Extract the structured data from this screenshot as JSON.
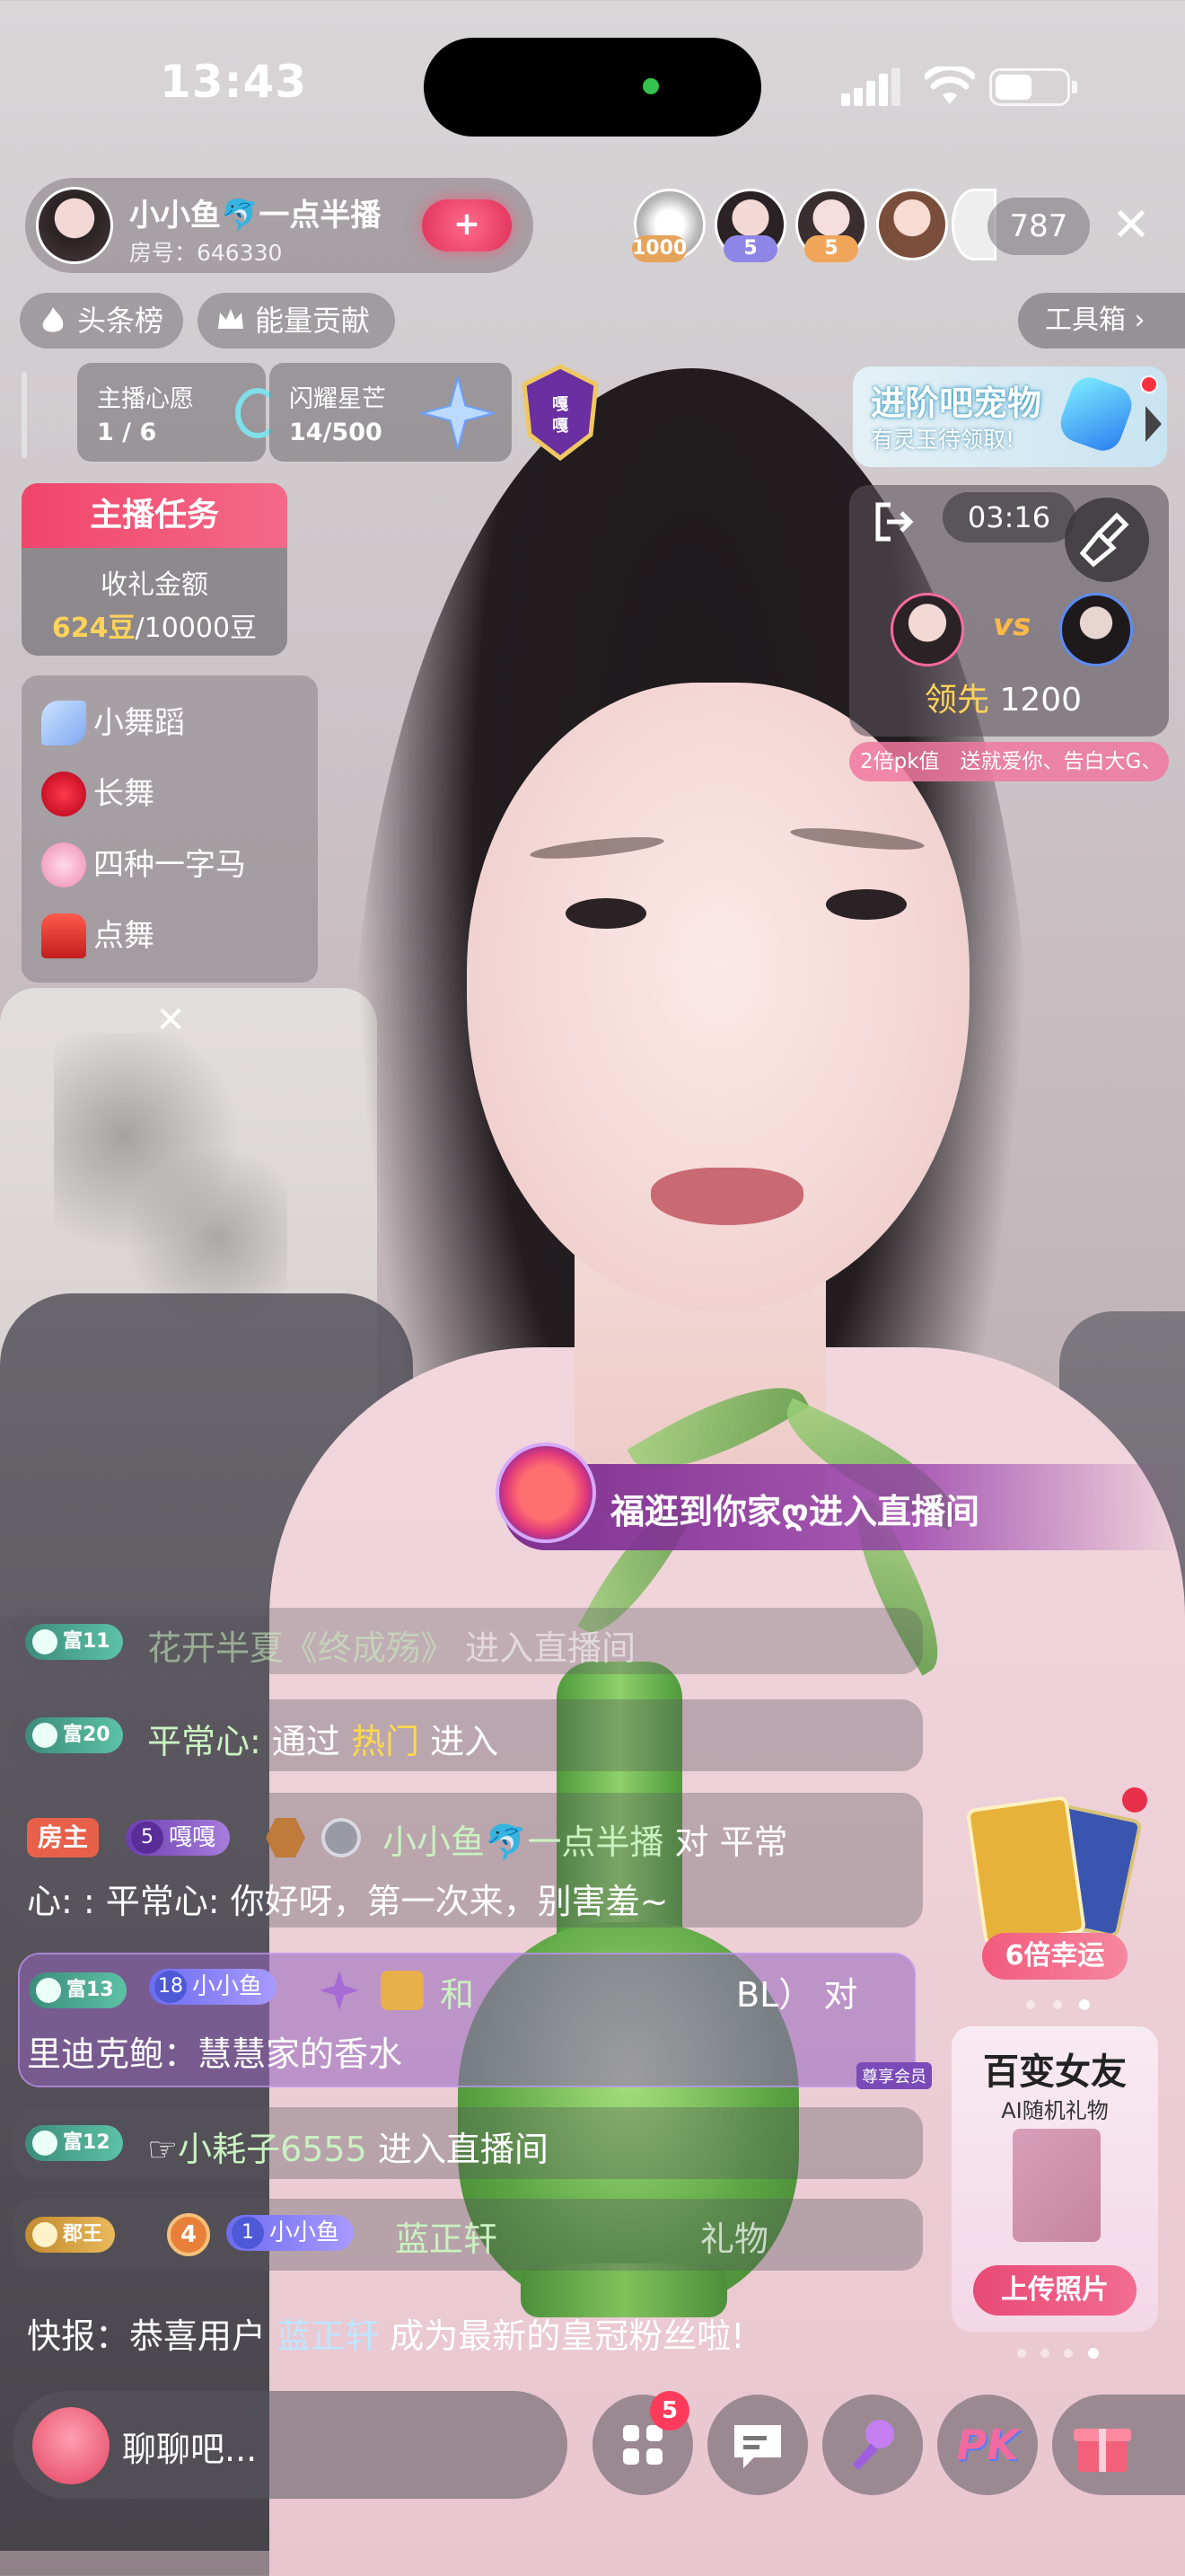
{
  "status_bar": {
    "time": "13:43"
  },
  "host": {
    "name": "小小鱼🐬一点半播",
    "room": "房号：646330",
    "follow_symbol": "+"
  },
  "viewers": {
    "badges": [
      "1000",
      "5",
      "5"
    ],
    "count": "787",
    "close": "✕"
  },
  "top_pills": {
    "headline": "头条榜",
    "energy": "能量贡献",
    "toolbox": "工具箱"
  },
  "missions": {
    "wish_title": "主播心愿",
    "wish_value": "1 / 6",
    "star_title": "闪耀星芒",
    "star_value": "14/500",
    "emblem": "嘎嘎"
  },
  "pet_promo": {
    "title": "进阶吧宠物",
    "subtitle": "有灵玉待领取!"
  },
  "anchor_task": {
    "title": "主播任务",
    "label": "收礼金额",
    "current": "624豆",
    "target": "/10000豆"
  },
  "dance_list": {
    "items": [
      "小舞蹈",
      "长舞",
      "四种一字马",
      "点舞"
    ],
    "close": "✕"
  },
  "pk": {
    "timer": "03:16",
    "vs": "vs",
    "lead_label": "领先",
    "lead_value": "1200",
    "ticker": "2倍pk值　送就爱你、告白大G、"
  },
  "entry_banner": {
    "text": "福逛到你家ღ进入直播间"
  },
  "chat": {
    "row1": {
      "level": "富11",
      "name": "花开半夏《终成殇》",
      "action": "进入直播间"
    },
    "row2": {
      "level": "富20",
      "name": "平常心:",
      "via": "通过",
      "source": "热门",
      "action": "进入"
    },
    "row3": {
      "role": "房主",
      "fan_level": "5",
      "fan_name": "嘎嘎",
      "line1_name": "小小鱼🐬一点半播",
      "line1_rest": "对 平常",
      "line2": "心: : 平常心:  你好呀，第一次来，别害羞~"
    },
    "row4": {
      "level": "富13",
      "fan_level": "18",
      "fan_name": "小小鱼",
      "line1": "和",
      "line1_tail": "BL） 对",
      "line2": "里迪克鲍：慧慧家的香水",
      "vip": "尊享会员"
    },
    "row5": {
      "level": "富12",
      "name": "小耗子6555",
      "action": "进入直播间"
    },
    "row6": {
      "rank": "郡王",
      "fan_level": "1",
      "fan_name": "小小鱼",
      "name": "蓝正轩",
      "tail": "礼物"
    },
    "news_label": "快报：",
    "news_text": "恭喜用户",
    "news_user": "蓝正轩",
    "news_tail": "成为最新的皇冠粉丝啦!"
  },
  "right_promos": {
    "lucky": "6倍幸运",
    "gf_title": "百变女友",
    "gf_sub": "AI随机礼物",
    "gf_button": "上传照片"
  },
  "bottom_bar": {
    "placeholder": "聊聊吧...",
    "apps_badge": "5",
    "pk_label": "PK"
  }
}
